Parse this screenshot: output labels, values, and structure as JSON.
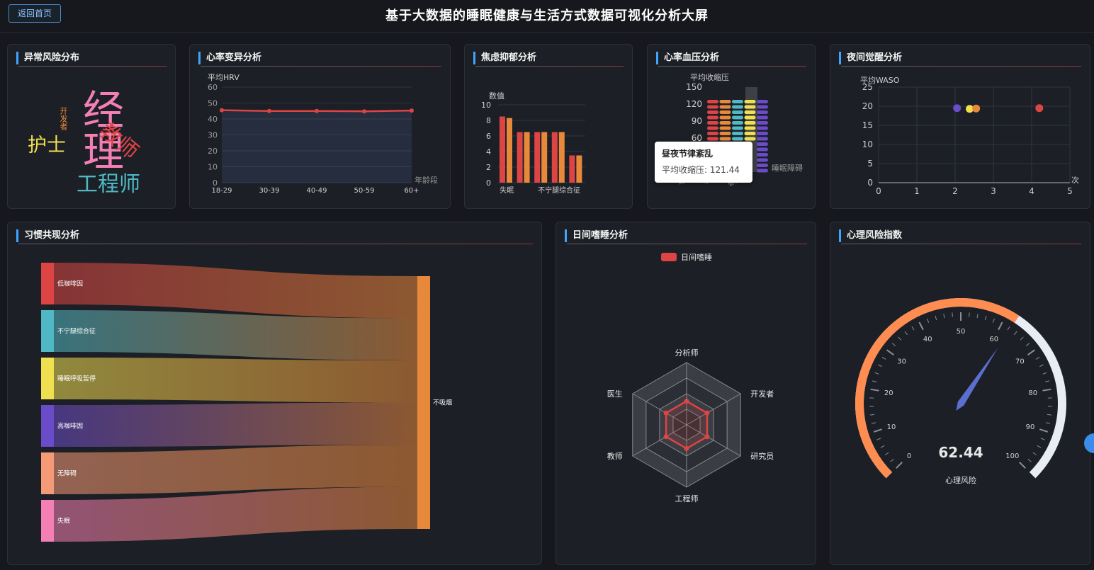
{
  "header": {
    "back_label": "返回首页",
    "title": "基于大数据的睡眠健康与生活方式数据可视化分析大屏"
  },
  "panels": {
    "anomaly": {
      "title": "异常风险分布"
    },
    "hrv": {
      "title": "心率变异分析"
    },
    "anxiety": {
      "title": "焦虑抑郁分析"
    },
    "bp": {
      "title": "心率血压分析"
    },
    "waso": {
      "title": "夜间觉醒分析"
    },
    "habit": {
      "title": "习惯共现分析"
    },
    "sleepiness": {
      "title": "日间嗜睡分析"
    },
    "psych": {
      "title": "心理风险指数"
    }
  },
  "tooltip": {
    "title": "昼夜节律紊乱",
    "label": "平均收缩压",
    "value": "121.44"
  },
  "colors": {
    "accent": "#3ea6ff",
    "red": "#dd4444",
    "orange": "#e8883a",
    "yellow": "#f0e050",
    "teal": "#4fb8c4",
    "purple": "#6a4bc8",
    "pink": "#f47fb5",
    "salmon": "#f59a77"
  },
  "chart_data": [
    {
      "id": "wordcloud",
      "type": "wordcloud",
      "words": [
        {
          "text": "经理",
          "color": "#f47fb5",
          "rank": 1
        },
        {
          "text": "工程师",
          "color": "#4fb8c4",
          "rank": 2
        },
        {
          "text": "教师",
          "color": "#dd4444",
          "rank": 3
        },
        {
          "text": "护士",
          "color": "#f0e050",
          "rank": 4
        },
        {
          "text": "开发者",
          "color": "#e8883a",
          "rank": 5
        }
      ]
    },
    {
      "id": "hrv",
      "type": "area",
      "categories": [
        "18-29",
        "30-39",
        "40-49",
        "50-59",
        "60+"
      ],
      "values": [
        45.5,
        45,
        45,
        44.8,
        45.3
      ],
      "ylabel": "平均HRV",
      "xlabel": "年龄段",
      "ylim": [
        0,
        60
      ],
      "yticks": [
        0,
        10,
        20,
        30,
        40,
        50,
        60
      ]
    },
    {
      "id": "anxiety",
      "type": "bar",
      "ylabel": "数值",
      "ylim": [
        0,
        10
      ],
      "yticks": [
        0,
        2,
        4,
        6,
        8,
        10
      ],
      "category_labels": [
        "失眠",
        "不宁腿综合征"
      ],
      "series": [
        {
          "values": [
            8.5,
            6.5,
            6.5,
            6.5,
            3.5
          ],
          "color": "#dd4444"
        },
        {
          "values": [
            8.3,
            6.5,
            6.5,
            6.5,
            3.5
          ],
          "color": "#e8883a"
        }
      ]
    },
    {
      "id": "bp",
      "type": "bar",
      "ylabel": "平均收缩压",
      "yticks": [
        60,
        90,
        120,
        150
      ],
      "ylim": [
        0,
        150
      ],
      "category_labels": [
        "睡眠...",
        "不宁...",
        "昼夜...",
        "睡眠障碍"
      ],
      "series_colors": [
        "#dd4444",
        "#e8883a",
        "#4fb8c4",
        "#f0e050",
        "#6a4bc8"
      ],
      "highlight_index": 3
    },
    {
      "id": "waso",
      "type": "scatter",
      "ylabel": "平均WASO",
      "xlabel": "次",
      "xlim": [
        0,
        5
      ],
      "ylim": [
        0,
        25
      ],
      "xticks": [
        0,
        1,
        2,
        3,
        4,
        5
      ],
      "yticks": [
        0,
        5,
        10,
        15,
        20,
        25
      ],
      "points": [
        {
          "x": 2.05,
          "y": 19.5,
          "color": "#6a4bc8"
        },
        {
          "x": 2.38,
          "y": 19.3,
          "color": "#f0e050"
        },
        {
          "x": 2.55,
          "y": 19.4,
          "color": "#e8883a"
        },
        {
          "x": 4.2,
          "y": 19.5,
          "color": "#dd4444"
        }
      ]
    },
    {
      "id": "sankey",
      "type": "sankey",
      "sources": [
        {
          "name": "低咖啡因",
          "color": "#dd4444"
        },
        {
          "name": "不宁腿综合征",
          "color": "#4fb8c4"
        },
        {
          "name": "睡眠呼吸暂停",
          "color": "#f0e050"
        },
        {
          "name": "高咖啡因",
          "color": "#6a4bc8"
        },
        {
          "name": "无障碍",
          "color": "#f59a77"
        },
        {
          "name": "失眠",
          "color": "#f47fb5"
        }
      ],
      "target": {
        "name": "不吸烟",
        "color": "#e8883a"
      }
    },
    {
      "id": "radar",
      "type": "radar",
      "legend": "日间嗜睡",
      "indicators": [
        "分析师",
        "开发者",
        "研究员",
        "工程师",
        "教师",
        "医生"
      ],
      "values": [
        0.38,
        0.38,
        0.38,
        0.38,
        0.38,
        0.38
      ],
      "color": "#dd4444"
    },
    {
      "id": "gauge",
      "type": "gauge",
      "value": 62.44,
      "value_text": "62.44",
      "label": "心理风险",
      "min": 0,
      "max": 100,
      "ticks": [
        0,
        10,
        20,
        30,
        40,
        50,
        60,
        70,
        80,
        90,
        100
      ]
    }
  ]
}
